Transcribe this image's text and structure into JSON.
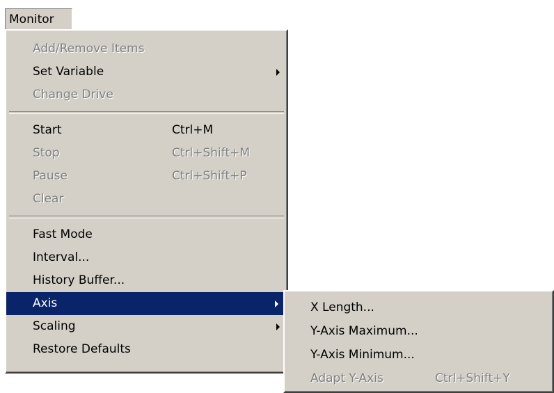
{
  "menubar": {
    "title": "Monitor"
  },
  "main_menu": {
    "groups": [
      [
        {
          "label": "Add/Remove Items",
          "shortcut": "",
          "enabled": false,
          "submenu": false
        },
        {
          "label": "Set Variable",
          "shortcut": "",
          "enabled": true,
          "submenu": true
        },
        {
          "label": "Change Drive",
          "shortcut": "",
          "enabled": false,
          "submenu": false
        }
      ],
      [
        {
          "label": "Start",
          "shortcut": "Ctrl+M",
          "enabled": true,
          "submenu": false
        },
        {
          "label": "Stop",
          "shortcut": "Ctrl+Shift+M",
          "enabled": false,
          "submenu": false
        },
        {
          "label": "Pause",
          "shortcut": "Ctrl+Shift+P",
          "enabled": false,
          "submenu": false
        },
        {
          "label": "Clear",
          "shortcut": "",
          "enabled": false,
          "submenu": false
        }
      ],
      [
        {
          "label": "Fast Mode",
          "shortcut": "",
          "enabled": true,
          "submenu": false
        },
        {
          "label": "Interval...",
          "shortcut": "",
          "enabled": true,
          "submenu": false
        },
        {
          "label": "History Buffer...",
          "shortcut": "",
          "enabled": true,
          "submenu": false
        },
        {
          "label": "Axis",
          "shortcut": "",
          "enabled": true,
          "submenu": true,
          "selected": true
        },
        {
          "label": "Scaling",
          "shortcut": "",
          "enabled": true,
          "submenu": true
        },
        {
          "label": "Restore Defaults",
          "shortcut": "",
          "enabled": true,
          "submenu": false
        }
      ]
    ]
  },
  "axis_submenu": {
    "items": [
      {
        "label": "X Length...",
        "shortcut": "",
        "enabled": true
      },
      {
        "label": "Y-Axis Maximum...",
        "shortcut": "",
        "enabled": true
      },
      {
        "label": "Y-Axis Minimum...",
        "shortcut": "",
        "enabled": true
      },
      {
        "label": "Adapt Y-Axis",
        "shortcut": "Ctrl+Shift+Y",
        "enabled": false
      }
    ]
  },
  "colors": {
    "menu_face": "#d4d0c8",
    "highlight": "#0a246a",
    "disabled_text": "#808080"
  }
}
